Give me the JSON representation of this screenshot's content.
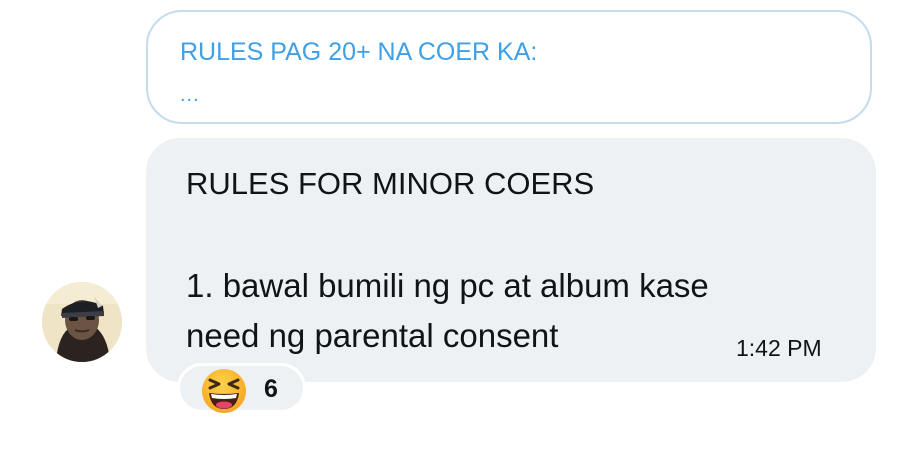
{
  "reply_preview": {
    "title": "RULES PAG 20+ NA COER KA:",
    "ellipsis": "..."
  },
  "message": {
    "heading": "RULES FOR MINOR COERS",
    "body_line_1": "1. bawal bumili ng pc at album kase",
    "body_line_2": "need ng parental consent",
    "time": "1:42 PM"
  },
  "reaction": {
    "emoji_name": "grinning-squinting-face-icon",
    "count": "6"
  },
  "colors": {
    "accent": "#3fa0e6",
    "bubble": "#eef1f3",
    "text": "#0f1419"
  }
}
